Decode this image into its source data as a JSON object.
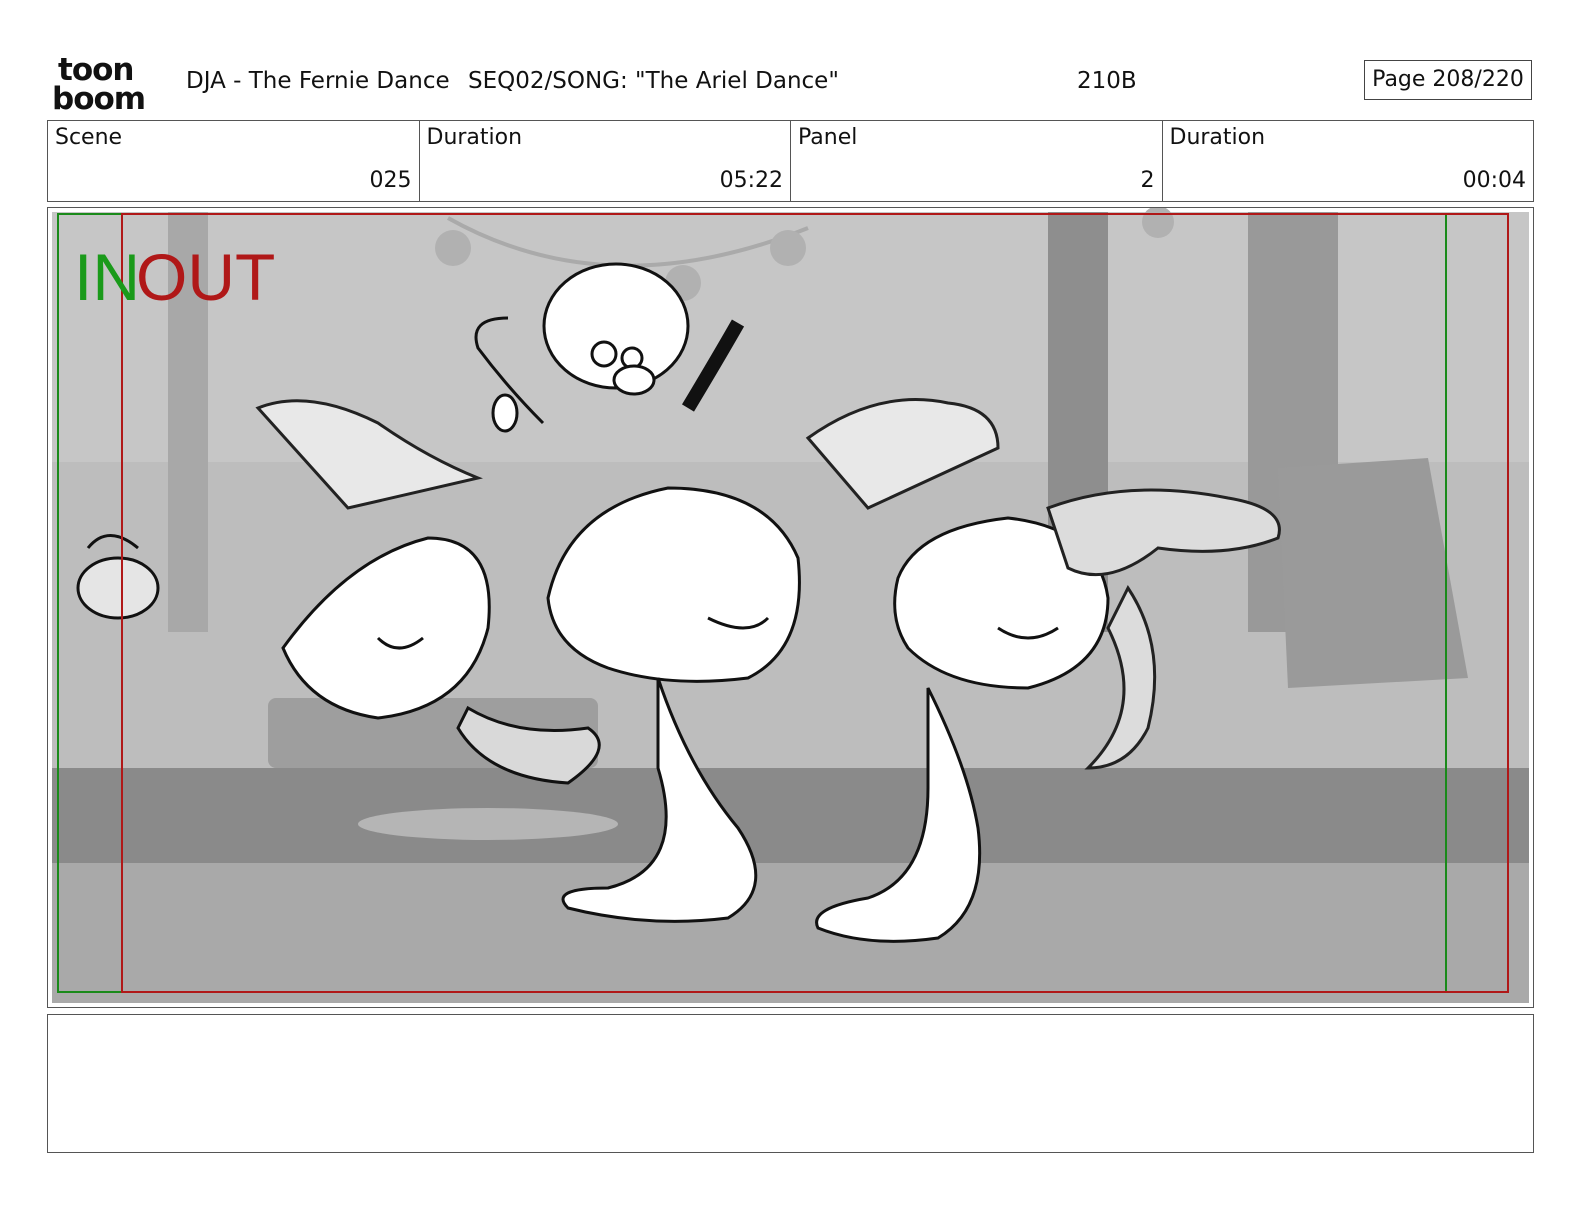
{
  "header": {
    "logo_top": "toon",
    "logo_bottom": "boom",
    "project": "DJA - The Fernie Dance",
    "sequence": "SEQ02/SONG: \"The Ariel Dance\"",
    "shot_code": "210B",
    "page": "Page 208/220"
  },
  "info": {
    "scene_label": "Scene",
    "scene_value": "025",
    "scene_duration_label": "Duration",
    "scene_duration_value": "05:22",
    "panel_label": "Panel",
    "panel_value": "2",
    "panel_duration_label": "Duration",
    "panel_duration_value": "00:04"
  },
  "panel": {
    "in_label": "IN",
    "out_label": "OUT",
    "in_color": "#1a9a1a",
    "out_color": "#b01818"
  },
  "notes": {
    "text": ""
  }
}
